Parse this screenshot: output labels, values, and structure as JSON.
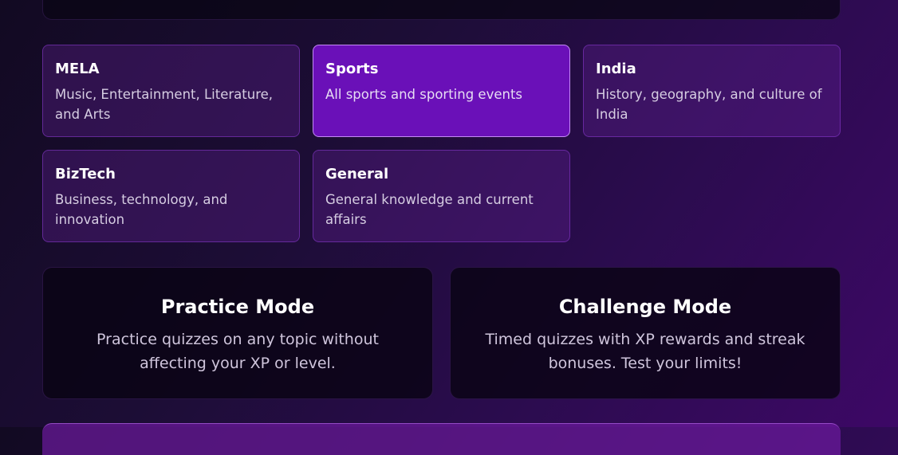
{
  "categories": [
    {
      "title": "MELA",
      "description": "Music, Entertainment, Literature, and Arts",
      "selected": false
    },
    {
      "title": "Sports",
      "description": "All sports and sporting events",
      "selected": true
    },
    {
      "title": "India",
      "description": "History, geography, and culture of India",
      "selected": false
    },
    {
      "title": "BizTech",
      "description": "Business, technology, and innovation",
      "selected": false
    },
    {
      "title": "General",
      "description": "General knowledge and current affairs",
      "selected": false
    }
  ],
  "modes": [
    {
      "title": "Practice Mode",
      "description": "Practice quizzes on any topic without affecting your XP or level."
    },
    {
      "title": "Challenge Mode",
      "description": "Timed quizzes with XP rewards and streak bonuses. Test your limits!"
    }
  ],
  "colors": {
    "selected_card": "#6a10b8",
    "card_bg": "#2f1250",
    "mode_card_bg": "#0a0414"
  }
}
